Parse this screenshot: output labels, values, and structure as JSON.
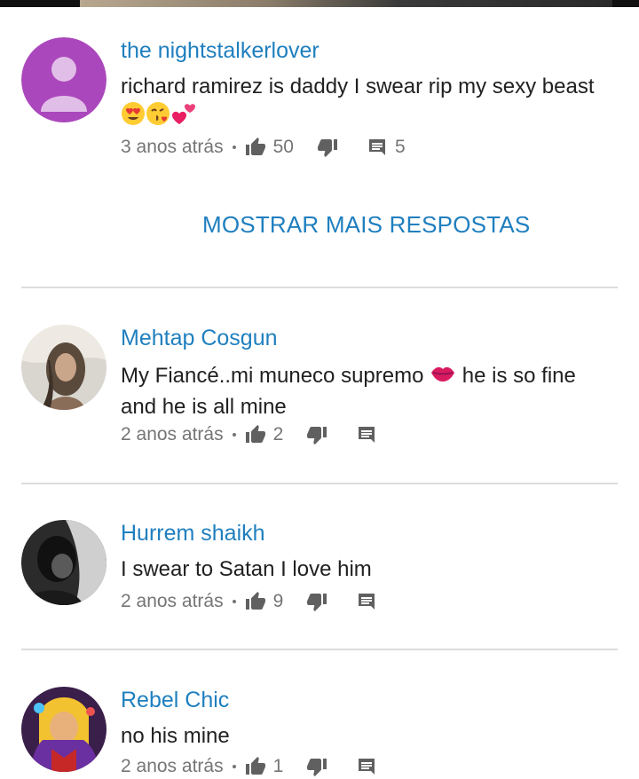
{
  "comments": [
    {
      "author": "the nightstalkerlover",
      "text": "richard ramirez is daddy I swear rip my sexy beast",
      "time": "3 anos atrás",
      "likes": "50",
      "replies": "5",
      "avatar": "default-purple-person"
    },
    {
      "author": "Mehtap Cosgun",
      "text_before": "My Fiancé..mi muneco supremo",
      "text_after": "he is so fine and he is all mine",
      "time": "2 anos atrás",
      "likes": "2",
      "avatar": "photo-woman"
    },
    {
      "author": "Hurrem shaikh",
      "text": "I swear to Satan I love him",
      "time": "2 anos atrás",
      "likes": "9",
      "avatar": "photo-dark"
    },
    {
      "author": "Rebel Chic",
      "text": "no his mine",
      "time": "2 anos atrás",
      "likes": "1",
      "avatar": "photo-illustration"
    }
  ],
  "show_more_label": "MOSTRAR MAIS RESPOSTAS",
  "colors": {
    "author": "#1f7fbf",
    "meta": "#757575",
    "divider": "#dcdcdc",
    "default_avatar": "#ab47bc"
  },
  "icons": {
    "like": "thumbs-up-icon",
    "dislike": "thumbs-down-icon",
    "reply": "reply-comment-icon",
    "emojis": [
      "heart-eyes-emoji",
      "kissing-heart-emoji",
      "two-hearts-emoji",
      "kiss-lips-emoji"
    ]
  }
}
